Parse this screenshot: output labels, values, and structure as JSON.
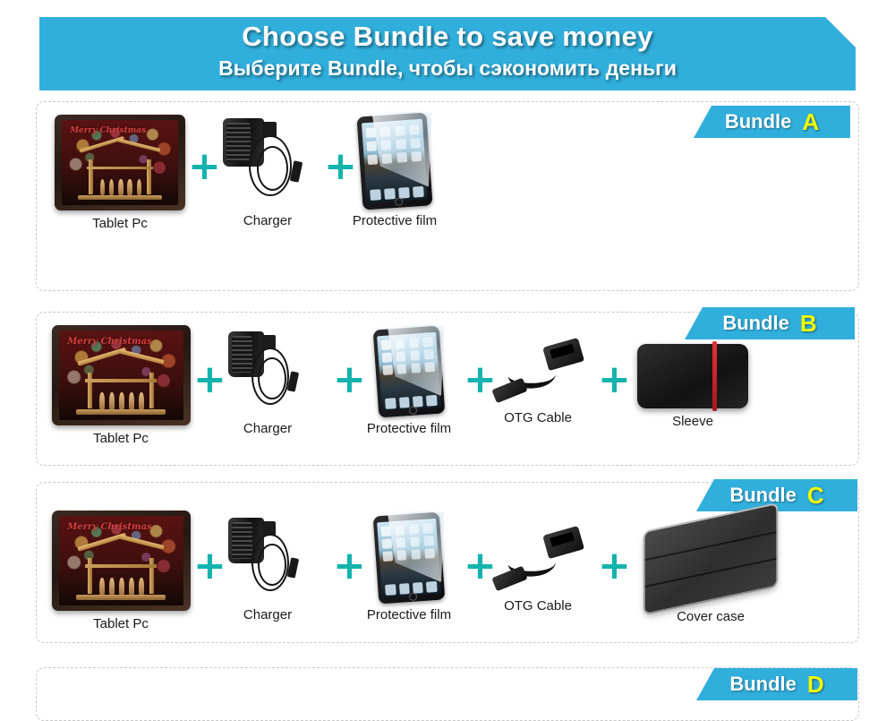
{
  "banner": {
    "title": "Choose Bundle to save money",
    "subtitle": "Выберите Bundle, чтобы сэкономить деньги",
    "color": "#31afdc",
    "fold_color": "#1d7ea0"
  },
  "theme": {
    "plus_color": "#14b3ad",
    "tag_color": "#31afdc",
    "tag_letter_color": "#f2ff00",
    "panel_border_color": "#c9c9c9",
    "label_color": "#1a1a1a",
    "background": "#ffffff"
  },
  "tag_word": "Bundle",
  "plus_symbol": "+",
  "tablet_screen_text": "Merry Christmas",
  "bundles": [
    {
      "letter": "A",
      "items": [
        {
          "label": "Tablet Pc",
          "art": "tablet"
        },
        {
          "label": "Charger",
          "art": "charger"
        },
        {
          "label": "Protective film",
          "art": "film"
        }
      ]
    },
    {
      "letter": "B",
      "items": [
        {
          "label": "Tablet Pc",
          "art": "tablet"
        },
        {
          "label": "Charger",
          "art": "charger"
        },
        {
          "label": "Protective film",
          "art": "film"
        },
        {
          "label": "OTG Cable",
          "art": "otg"
        },
        {
          "label": "Sleeve",
          "art": "sleeve"
        }
      ]
    },
    {
      "letter": "C",
      "items": [
        {
          "label": "Tablet Pc",
          "art": "tablet"
        },
        {
          "label": "Charger",
          "art": "charger"
        },
        {
          "label": "Protective film",
          "art": "film"
        },
        {
          "label": "OTG Cable",
          "art": "otg"
        },
        {
          "label": "Cover case",
          "art": "cover"
        }
      ]
    },
    {
      "letter": "D",
      "items": []
    }
  ]
}
